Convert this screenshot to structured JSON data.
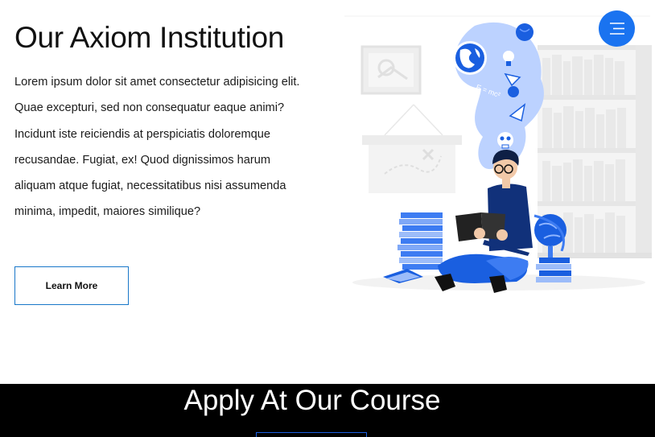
{
  "hero": {
    "title": "Our Axiom Institution",
    "paragraph": "Lorem ipsum dolor sit amet consectetur adipisicing elit. Quae excepturi, sed non consequatur eaque animi? Incidunt iste reiciendis at perspiciatis doloremque recusandae. Fugiat, ex! Quod dignissimos harum aliquam atque fugiat, necessitatibus nisi assumenda minima, impedit, maiores similique?",
    "button_label": "Learn More"
  },
  "illustration": {
    "formula": "E = mc²"
  },
  "menu": {
    "icon": "hamburger-menu-icon"
  },
  "apply": {
    "title": "Apply At Our Course"
  },
  "colors": {
    "accent": "#1a73f0",
    "button_border": "#1877c9",
    "band": "#000000",
    "text": "#111111"
  }
}
